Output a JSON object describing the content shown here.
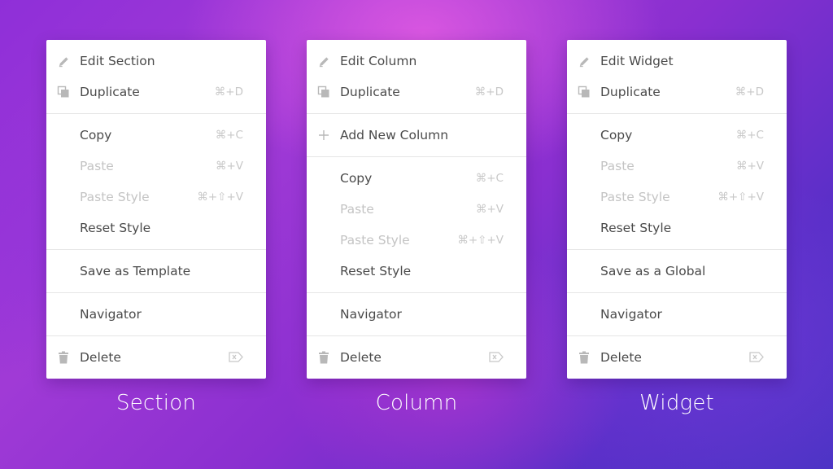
{
  "menus": [
    {
      "caption": "Section",
      "groups": [
        [
          {
            "icon": "pencil-icon",
            "label": "Edit Section",
            "shortcut": "",
            "disabled": false
          },
          {
            "icon": "duplicate-icon",
            "label": "Duplicate",
            "shortcut": "⌘+D",
            "disabled": false
          }
        ],
        [
          {
            "icon": "",
            "label": "Copy",
            "shortcut": "⌘+C",
            "disabled": false
          },
          {
            "icon": "",
            "label": "Paste",
            "shortcut": "⌘+V",
            "disabled": true
          },
          {
            "icon": "",
            "label": "Paste Style",
            "shortcut": "⌘+⇧+V",
            "disabled": true
          },
          {
            "icon": "",
            "label": "Reset Style",
            "shortcut": "",
            "disabled": false
          }
        ],
        [
          {
            "icon": "",
            "label": "Save as Template",
            "shortcut": "",
            "disabled": false
          }
        ],
        [
          {
            "icon": "",
            "label": "Navigator",
            "shortcut": "",
            "disabled": false
          }
        ],
        [
          {
            "icon": "trash-icon",
            "label": "Delete",
            "shortcut": "⌦",
            "disabled": false
          }
        ]
      ]
    },
    {
      "caption": "Column",
      "groups": [
        [
          {
            "icon": "pencil-icon",
            "label": "Edit Column",
            "shortcut": "",
            "disabled": false
          },
          {
            "icon": "duplicate-icon",
            "label": "Duplicate",
            "shortcut": "⌘+D",
            "disabled": false
          }
        ],
        [
          {
            "icon": "plus-icon",
            "label": "Add New Column",
            "shortcut": "",
            "disabled": false
          }
        ],
        [
          {
            "icon": "",
            "label": "Copy",
            "shortcut": "⌘+C",
            "disabled": false
          },
          {
            "icon": "",
            "label": "Paste",
            "shortcut": "⌘+V",
            "disabled": true
          },
          {
            "icon": "",
            "label": "Paste Style",
            "shortcut": "⌘+⇧+V",
            "disabled": true
          },
          {
            "icon": "",
            "label": "Reset Style",
            "shortcut": "",
            "disabled": false
          }
        ],
        [
          {
            "icon": "",
            "label": "Navigator",
            "shortcut": "",
            "disabled": false
          }
        ],
        [
          {
            "icon": "trash-icon",
            "label": "Delete",
            "shortcut": "⌦",
            "disabled": false
          }
        ]
      ]
    },
    {
      "caption": "Widget",
      "groups": [
        [
          {
            "icon": "pencil-icon",
            "label": "Edit Widget",
            "shortcut": "",
            "disabled": false
          },
          {
            "icon": "duplicate-icon",
            "label": "Duplicate",
            "shortcut": "⌘+D",
            "disabled": false
          }
        ],
        [
          {
            "icon": "",
            "label": "Copy",
            "shortcut": "⌘+C",
            "disabled": false
          },
          {
            "icon": "",
            "label": "Paste",
            "shortcut": "⌘+V",
            "disabled": true
          },
          {
            "icon": "",
            "label": "Paste Style",
            "shortcut": "⌘+⇧+V",
            "disabled": true
          },
          {
            "icon": "",
            "label": "Reset Style",
            "shortcut": "",
            "disabled": false
          }
        ],
        [
          {
            "icon": "",
            "label": "Save as a Global",
            "shortcut": "",
            "disabled": false
          }
        ],
        [
          {
            "icon": "",
            "label": "Navigator",
            "shortcut": "",
            "disabled": false
          }
        ],
        [
          {
            "icon": "trash-icon",
            "label": "Delete",
            "shortcut": "⌦",
            "disabled": false
          }
        ]
      ]
    }
  ],
  "colors": {
    "icon": "#b3b3b3",
    "text": "#4a4a4a",
    "text_disabled": "#c4c4c4",
    "shortcut": "#c8c8c8"
  }
}
